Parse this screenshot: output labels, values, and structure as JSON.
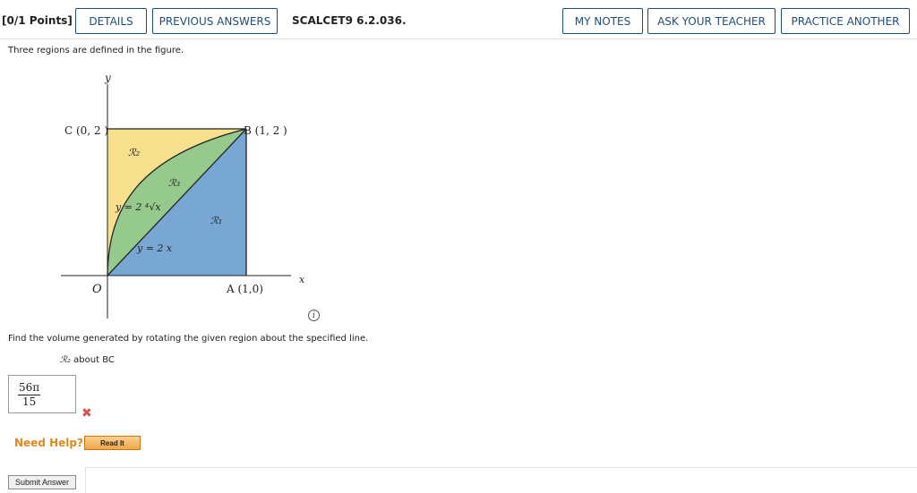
{
  "header": {
    "points": "[0/1 Points]",
    "details": "DETAILS",
    "previous_answers": "PREVIOUS ANSWERS",
    "reference": "SCALCET9 6.2.036.",
    "my_notes": "MY NOTES",
    "ask_teacher": "ASK YOUR TEACHER",
    "practice_another": "PRACTICE ANOTHER"
  },
  "prompt": "Three regions are defined in the figure.",
  "figure": {
    "axis_y": "y",
    "axis_x": "x",
    "label_c": "C (0, 2 )",
    "label_b": "B (1, 2 )",
    "label_o": "O",
    "label_a": "A (1,0)",
    "region_1": "ℛ₁",
    "region_2": "ℛ₂",
    "region_3": "ℛ₃",
    "curve_root": "y = 2 ⁴√x",
    "curve_line": "y = 2 x",
    "colors": {
      "r1": "#78a7d3",
      "r2": "#f6e08e",
      "r3": "#96c98c"
    }
  },
  "info_icon": "i",
  "question": "Find the volume generated by rotating the given region about the specified line.",
  "subquestion": {
    "region": "ℛ₂",
    "text": " about BC"
  },
  "answer": {
    "numerator": "56π",
    "denominator": "15",
    "status_icon": "✖"
  },
  "need_help": "Need Help?",
  "read_it": "Read It",
  "submit": "Submit Answer"
}
